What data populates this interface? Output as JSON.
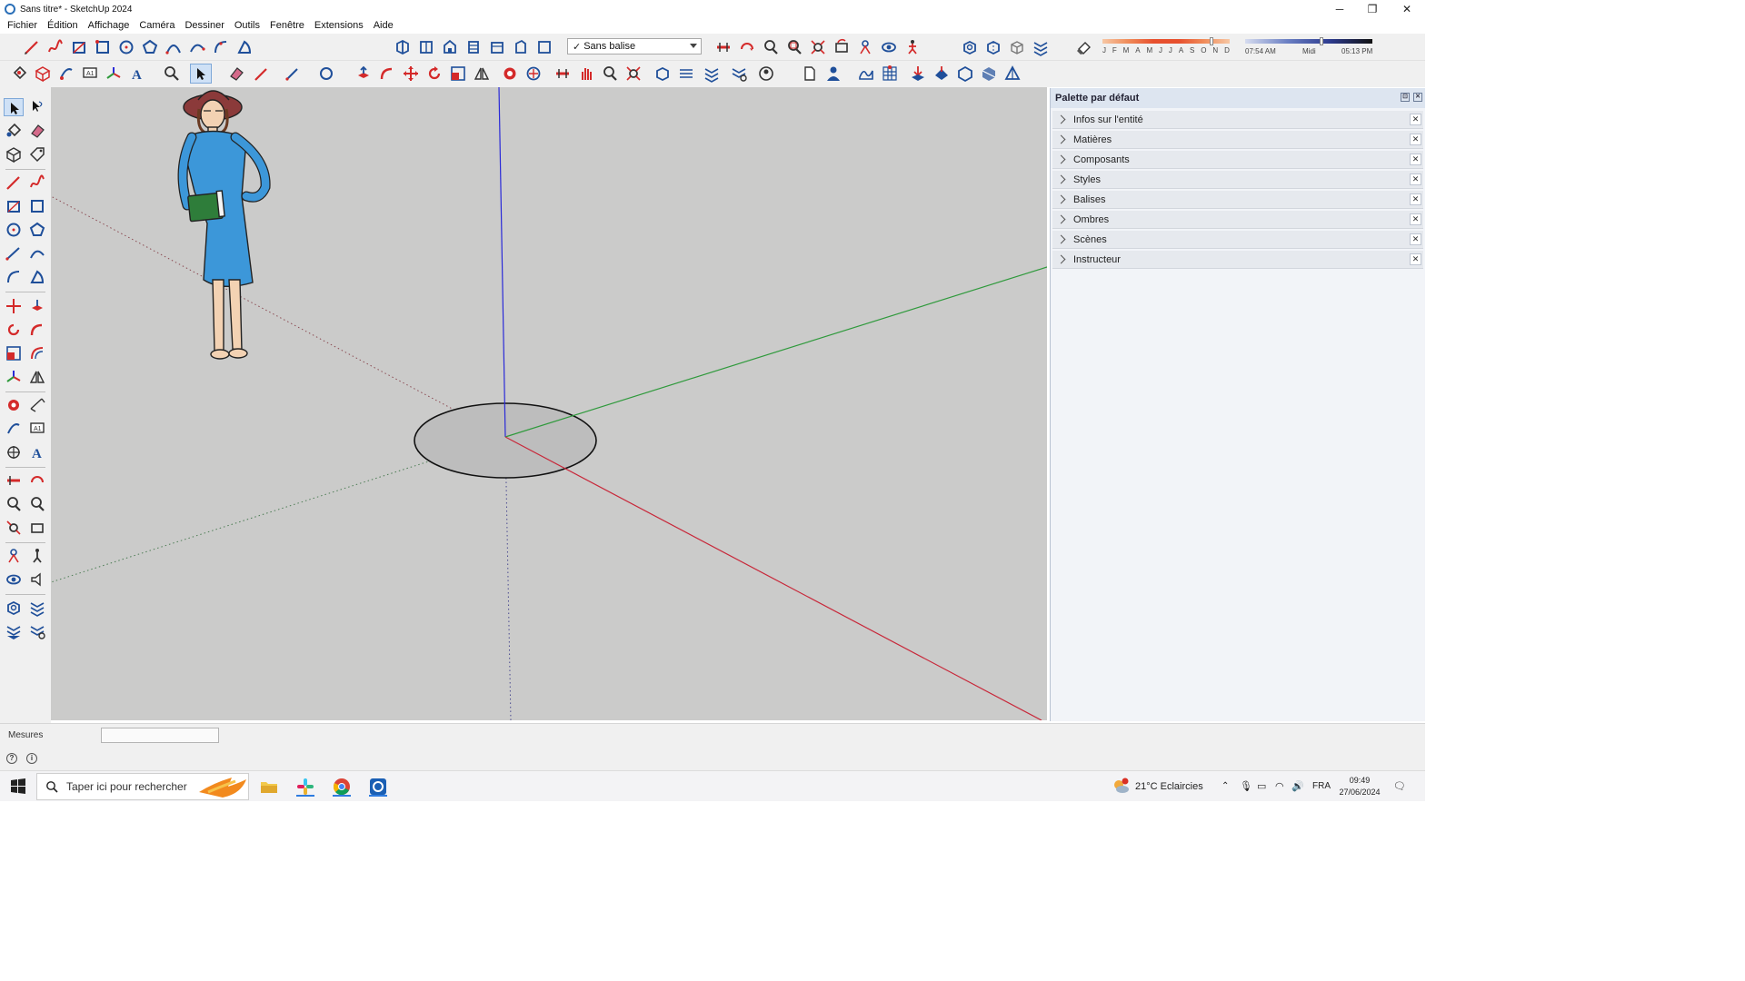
{
  "window": {
    "title": "Sans titre* - SketchUp 2024",
    "controls": [
      "─",
      "❐",
      "✕"
    ]
  },
  "menu": [
    "Fichier",
    "Édition",
    "Affichage",
    "Caméra",
    "Dessiner",
    "Outils",
    "Fenêtre",
    "Extensions",
    "Aide"
  ],
  "tag_select": {
    "value": "Sans balise",
    "checkmark": "✓"
  },
  "shadows": {
    "months": [
      "J",
      "F",
      "M",
      "A",
      "M",
      "J",
      "J",
      "A",
      "S",
      "O",
      "N",
      "D"
    ],
    "time_start": "07:54 AM",
    "time_mid": "Midi",
    "time_end": "05:13 PM"
  },
  "palette": {
    "title": "Palette par défaut",
    "trays": [
      {
        "label": "Infos sur l'entité"
      },
      {
        "label": "Matières"
      },
      {
        "label": "Composants"
      },
      {
        "label": "Styles"
      },
      {
        "label": "Balises"
      },
      {
        "label": "Ombres"
      },
      {
        "label": "Scènes"
      },
      {
        "label": "Instructeur"
      }
    ],
    "close_glyph": "✕"
  },
  "status": {
    "measure_label": "Mesures",
    "measure_value": "",
    "help_glyph": "?",
    "info_glyph": "i"
  },
  "taskbar": {
    "search_placeholder": "Taper ici pour rechercher",
    "weather": "21°C  Eclaircies",
    "language": "FRA",
    "time": "09:49",
    "date": "27/06/2024"
  },
  "colors": {
    "axis_red": "#c8283a",
    "axis_green": "#2f9a3c",
    "axis_blue": "#2a2ad8",
    "viewport_bg": "#cbcbca",
    "tool_red": "#d42a2a",
    "tool_blue": "#1f4f9a"
  }
}
